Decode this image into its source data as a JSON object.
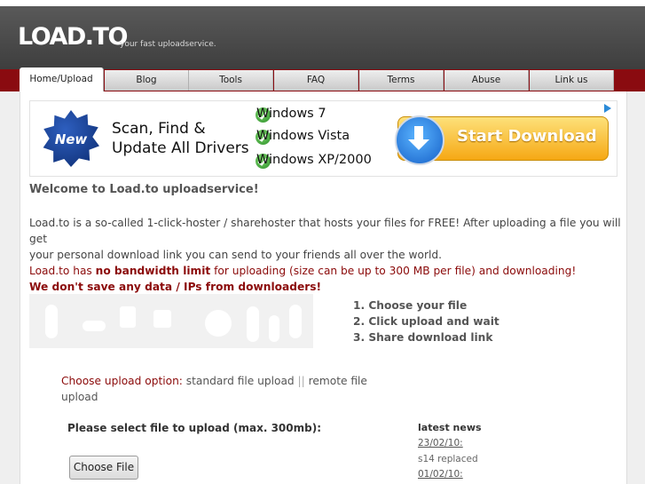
{
  "header": {
    "logo": "LOAD.TO",
    "slogan": "your fast uploadservice."
  },
  "nav": {
    "tabs": [
      {
        "label": "Home/Upload",
        "active": true
      },
      {
        "label": "Blog"
      },
      {
        "label": "Tools"
      },
      {
        "label": "FAQ"
      },
      {
        "label": "Terms"
      },
      {
        "label": "Abuse"
      },
      {
        "label": "Link us"
      }
    ]
  },
  "ad": {
    "badge": "New",
    "headline": "Scan, Find & Update All Drivers",
    "os": [
      "Windows 7",
      "Windows Vista",
      "Windows XP/2000"
    ],
    "button": "Start Download",
    "accent": "#f6a814"
  },
  "main": {
    "welcome": "Welcome to Load.to uploadservice!",
    "intro_line1": "Load.to is a so-called 1-click-hoster / sharehoster that hosts your files for FREE! After uploading a file you will get",
    "intro_line2": "your personal download link you can send to your friends all over the world.",
    "bandwidth_prefix": "Load.to has ",
    "bandwidth_bold": "no bandwidth limit",
    "bandwidth_suffix": " for uploading (size can be up to 300 MB per file) and downloading!",
    "privacy": "We don't save any data / IPs from downloaders!",
    "steps": [
      "1. Choose your file",
      "2. Click upload and wait",
      "3. Share download link"
    ],
    "upload_option_label": "Choose upload option:",
    "upload_option_standard": "standard file upload",
    "upload_option_separator": "||",
    "upload_option_remote": "remote file upload",
    "select_label": "Please select file to upload (max. 300mb):",
    "choose_button": "Choose File"
  },
  "news": {
    "title": "latest news",
    "items": [
      {
        "date": "23/02/10:",
        "text": "s14 replaced"
      },
      {
        "date": "01/02/10:",
        "text": ""
      }
    ]
  },
  "colors": {
    "nav_bar": "#8a0b10",
    "header": "#4a4a4a",
    "highlight_red": "#8b0a0a"
  }
}
